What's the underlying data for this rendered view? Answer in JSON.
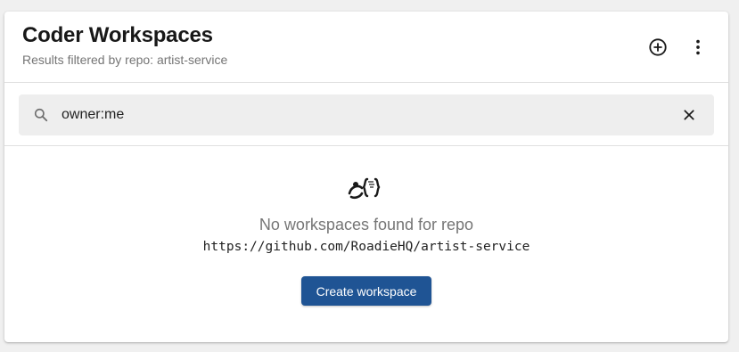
{
  "header": {
    "title": "Coder Workspaces",
    "subtitle": "Results filtered by repo: artist-service",
    "actions": {
      "add_icon": "add-circle-icon",
      "more_icon": "more-vert-icon"
    }
  },
  "search": {
    "value": "owner:me",
    "search_icon": "search-icon",
    "clear_icon": "close-icon"
  },
  "empty_state": {
    "logo_icon": "coder-logo-icon",
    "message": "No workspaces found for repo",
    "repo_url": "https://github.com/RoadieHQ/artist-service",
    "create_button_label": "Create workspace"
  },
  "colors": {
    "primary": "#1f5494",
    "muted_text": "#757575",
    "search_bg": "#eeeeee"
  }
}
